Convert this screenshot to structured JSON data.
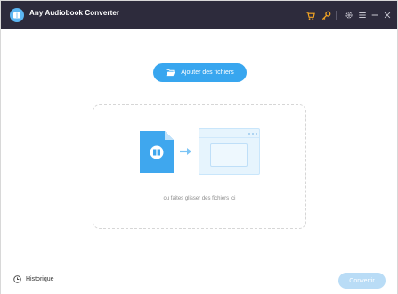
{
  "app": {
    "title": "Any Audiobook Converter"
  },
  "titlebar": {
    "icons": [
      "cart-icon",
      "key-icon",
      "settings-icon",
      "menu-icon",
      "minimize-icon",
      "close-icon"
    ],
    "accent_color": "#f5a623"
  },
  "main": {
    "add_button_label": "Ajouter des fichiers",
    "drop_hint": "ou faites glisser des fichiers ici"
  },
  "footer": {
    "history_label": "Historique",
    "convert_label": "Convertir"
  },
  "colors": {
    "titlebar_bg": "#2d2b3c",
    "primary": "#38a6ef",
    "primary_disabled": "#b9dcf6"
  }
}
